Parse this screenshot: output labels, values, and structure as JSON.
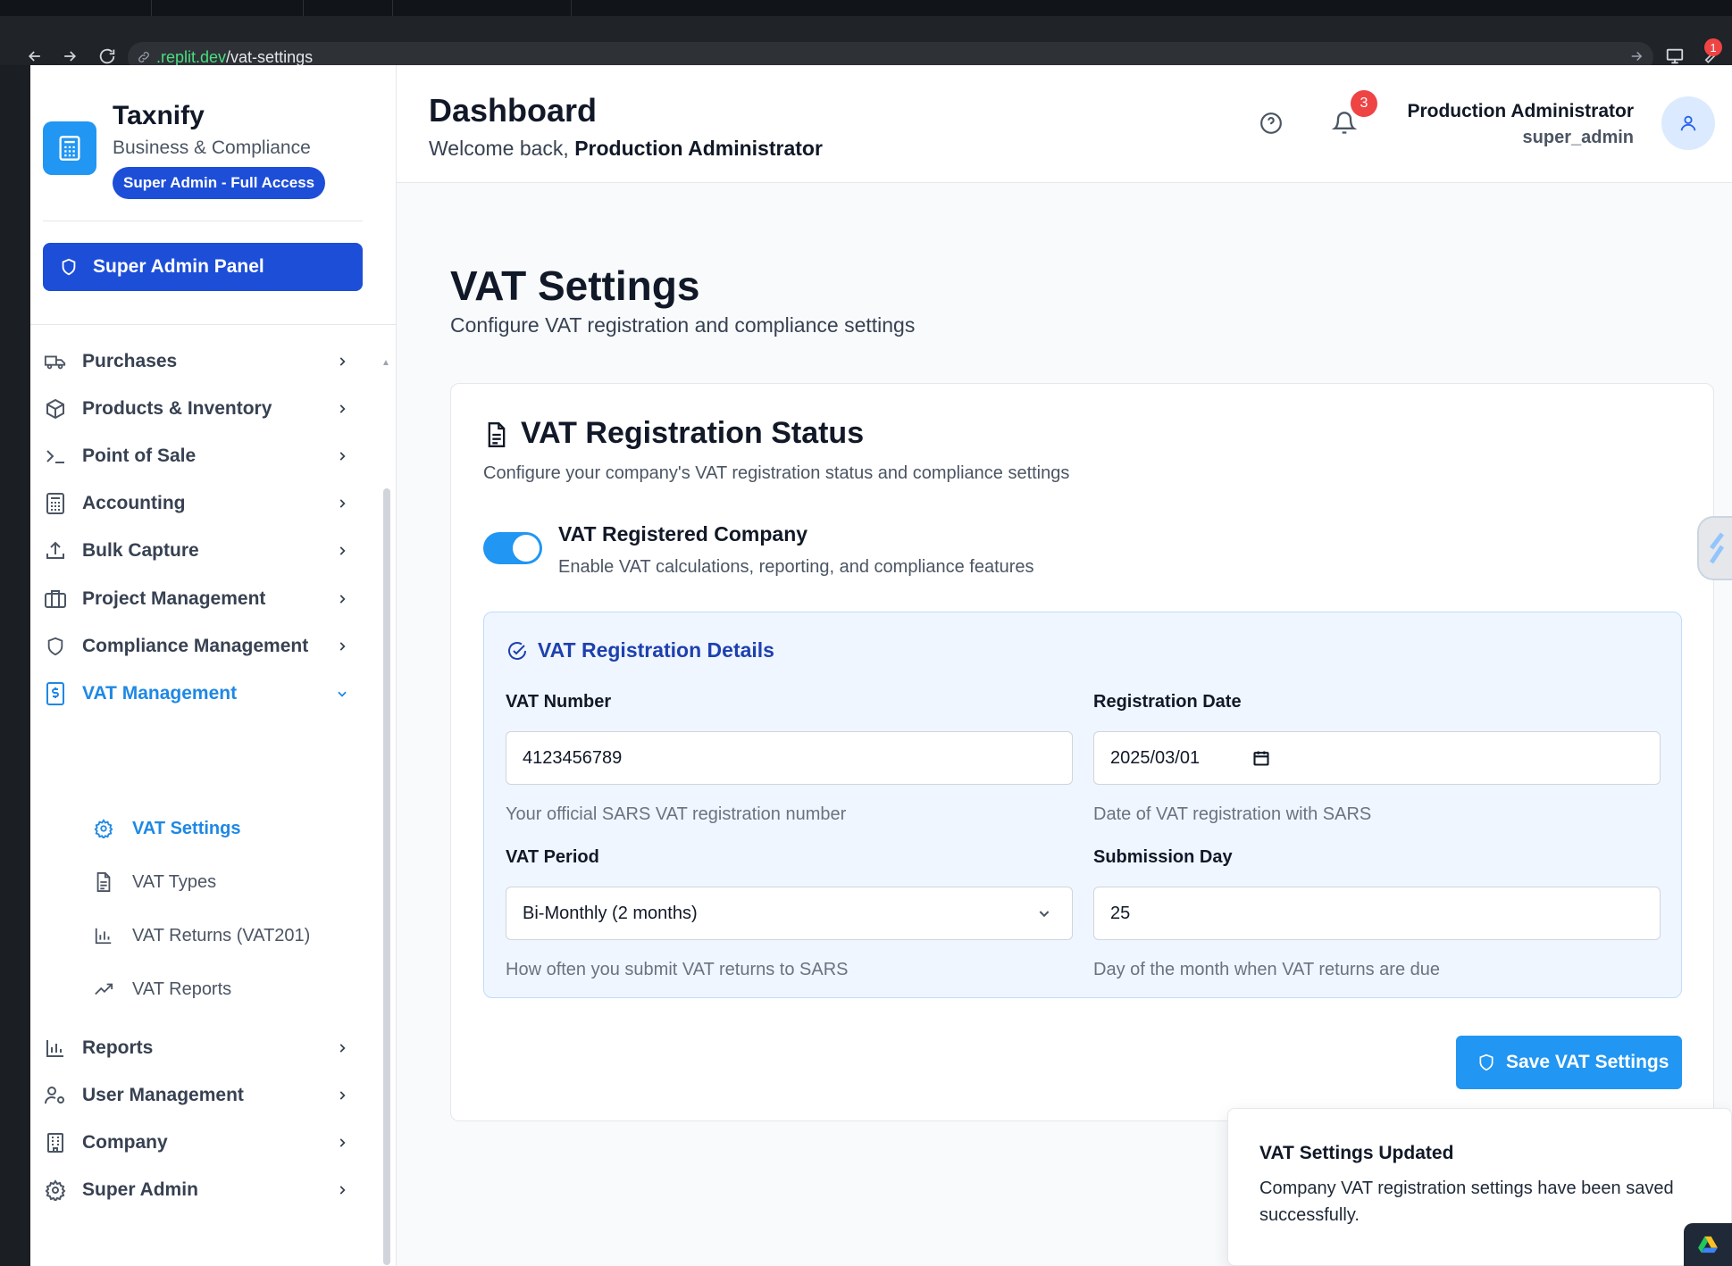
{
  "browser": {
    "url_green": ".replit.dev",
    "url_path": "/vat-settings",
    "extension_badge": "1"
  },
  "brand": {
    "name": "Taxnify",
    "subtitle": "Business & Compliance",
    "access_badge": "Super Admin - Full Access",
    "logo_icon": "calculator-icon"
  },
  "sidebar": {
    "super_admin_button": "Super Admin Panel",
    "items": [
      {
        "label": "Purchases",
        "icon": "truck-icon"
      },
      {
        "label": "Products & Inventory",
        "icon": "package-icon"
      },
      {
        "label": "Point of Sale",
        "icon": "terminal-icon"
      },
      {
        "label": "Accounting",
        "icon": "calculator-icon"
      },
      {
        "label": "Bulk Capture",
        "icon": "upload-icon"
      },
      {
        "label": "Project Management",
        "icon": "briefcase-icon"
      },
      {
        "label": "Compliance Management",
        "icon": "shield-icon"
      },
      {
        "label": "VAT Management",
        "icon": "dollar-receipt-icon",
        "expanded": true
      },
      {
        "label": "Reports",
        "icon": "bar-chart-icon"
      },
      {
        "label": "User Management",
        "icon": "user-cog-icon"
      },
      {
        "label": "Company",
        "icon": "building-icon"
      },
      {
        "label": "Super Admin",
        "icon": "gear-icon"
      }
    ],
    "vat_subitems": [
      {
        "label": "VAT Settings",
        "icon": "gear-icon",
        "active": true
      },
      {
        "label": "VAT Types",
        "icon": "document-icon"
      },
      {
        "label": "VAT Returns (VAT201)",
        "icon": "bar-chart-icon"
      },
      {
        "label": "VAT Reports",
        "icon": "trending-up-icon"
      }
    ]
  },
  "header": {
    "title": "Dashboard",
    "welcome_prefix": "Welcome back, ",
    "welcome_name": "Production Administrator",
    "notification_count": "3",
    "user_name": "Production Administrator",
    "user_role": "super_admin"
  },
  "page": {
    "title": "VAT Settings",
    "subtitle": "Configure VAT registration and compliance settings"
  },
  "card": {
    "title": "VAT Registration Status",
    "subtitle": "Configure your company's VAT registration status and compliance settings",
    "toggle_label": "VAT Registered Company",
    "toggle_desc": "Enable VAT calculations, reporting, and compliance features",
    "toggle_on": true
  },
  "details": {
    "title": "VAT Registration Details",
    "vat_number": {
      "label": "VAT Number",
      "value": "4123456789",
      "help": "Your official SARS VAT registration number"
    },
    "registration_date": {
      "label": "Registration Date",
      "value": "2025/03/01",
      "help": "Date of VAT registration with SARS"
    },
    "vat_period": {
      "label": "VAT Period",
      "value": "Bi-Monthly (2 months)",
      "help": "How often you submit VAT returns to SARS"
    },
    "submission_day": {
      "label": "Submission Day",
      "value": "25",
      "help": "Day of the month when VAT returns are due"
    }
  },
  "save_button": "Save VAT Settings",
  "toast": {
    "title": "VAT Settings Updated",
    "body": "Company VAT registration settings have been saved successfully."
  },
  "colors": {
    "accent": "#2196f3",
    "primary_dark": "#1d4ed8",
    "active_text": "#1e88e5",
    "badge_red": "#ef4444"
  }
}
